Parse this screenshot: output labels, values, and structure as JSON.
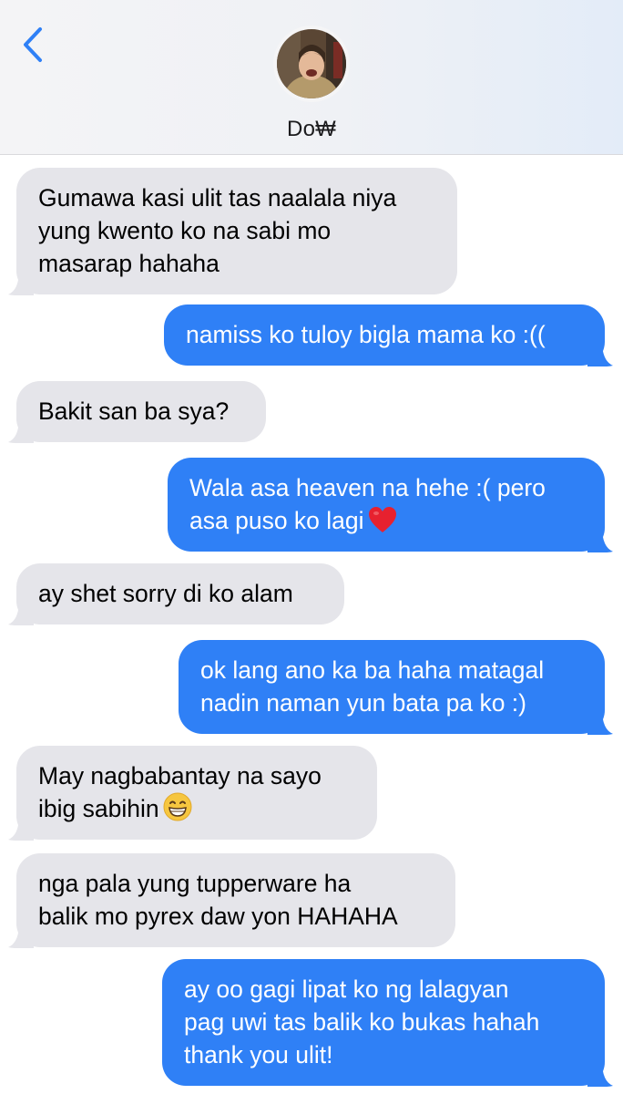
{
  "header": {
    "contact_name": "Do₩",
    "back_icon": "chevron-left-icon",
    "avatar": "contact-avatar-photo"
  },
  "colors": {
    "sent_bubble": "#2f80f6",
    "received_bubble": "#e5e5ea",
    "accent": "#2f80f6"
  },
  "messages": [
    {
      "direction": "received",
      "lines": [
        "Gumawa kasi ulit tas naalala niya",
        "yung kwento ko na sabi mo",
        "masarap hahaha"
      ]
    },
    {
      "direction": "sent",
      "lines": [
        "namiss ko tuloy bigla mama ko :(("
      ]
    },
    {
      "direction": "received",
      "lines": [
        "Bakit san ba sya?"
      ]
    },
    {
      "direction": "sent",
      "lines": [
        "Wala asa heaven na hehe :( pero",
        "asa puso ko lagi"
      ],
      "emoji": "red-heart-emoji"
    },
    {
      "direction": "received",
      "lines": [
        "ay shet sorry di ko alam"
      ]
    },
    {
      "direction": "sent",
      "lines": [
        "ok lang ano ka ba haha matagal",
        "nadin naman yun bata pa ko :)"
      ]
    },
    {
      "direction": "received",
      "lines": [
        "May nagbabantay na sayo",
        "ibig sabihin"
      ],
      "emoji": "grinning-face-emoji"
    },
    {
      "direction": "received",
      "lines": [
        "nga pala yung tupperware ha",
        "balik mo pyrex daw yon HAHAHA"
      ]
    },
    {
      "direction": "sent",
      "lines": [
        "ay oo gagi lipat ko ng lalagyan",
        "pag uwi tas balik ko bukas hahah",
        "thank you ulit!"
      ]
    }
  ]
}
